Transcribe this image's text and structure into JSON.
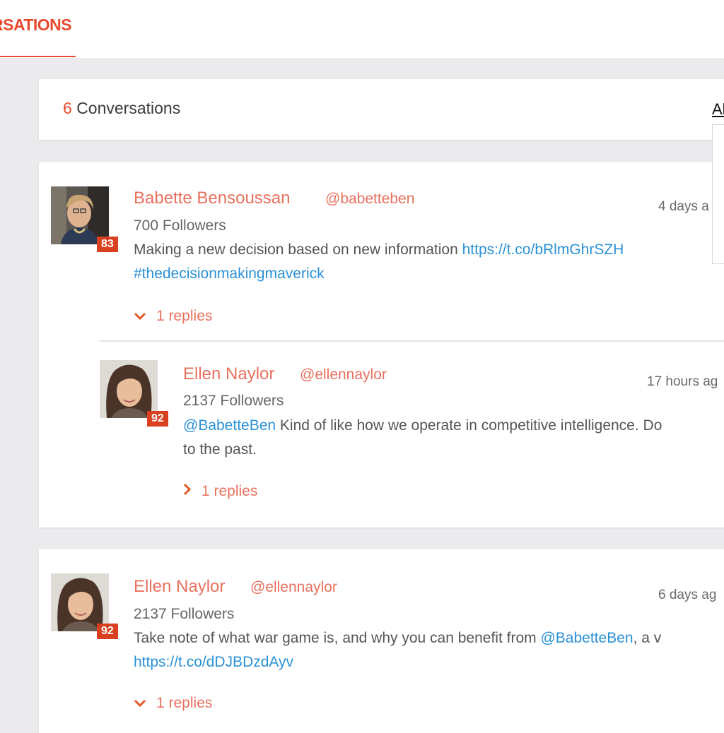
{
  "header": {
    "active_tab": "RSATIONS"
  },
  "summary": {
    "count": "6",
    "label": "Conversations",
    "filter_label": "Al"
  },
  "conversations": [
    {
      "author": {
        "name": "Babette Bensoussan",
        "handle": "@babetteben",
        "score": "83",
        "followers": "700 Followers",
        "time": "4 days a"
      },
      "text_line1": "Making a new decision based on new information ",
      "link1": "https://t.co/bRlmGhrSZH",
      "hashtag": "#thedecisionmakingmaverick",
      "replies": "1 replies",
      "reply": {
        "author": {
          "name": "Ellen Naylor",
          "handle": "@ellennaylor",
          "score": "92",
          "followers": "2137 Followers",
          "time": "17 hours ag"
        },
        "mention": "@BabetteBen",
        "text_line1": " Kind of like how we operate in competitive intelligence. Do",
        "text_line2": "to the past.",
        "replies": "1 replies"
      }
    },
    {
      "author": {
        "name": "Ellen Naylor",
        "handle": "@ellennaylor",
        "score": "92",
        "followers": "2137 Followers",
        "time": "6 days ag"
      },
      "text_line1": "Take note of what war game is, and why you can benefit from ",
      "mention": "@BabetteBen",
      "text_tail": ", a v",
      "link1": "https://t.co/dDJBDzdAyv",
      "replies": "1 replies"
    }
  ],
  "icons": {
    "expanded": "chevron-down-icon",
    "collapsed": "chevron-right-icon"
  },
  "colors": {
    "accent": "#e8492d",
    "name": "#e8715f",
    "link": "#2a91d6",
    "score_badge": "#d8401f"
  }
}
